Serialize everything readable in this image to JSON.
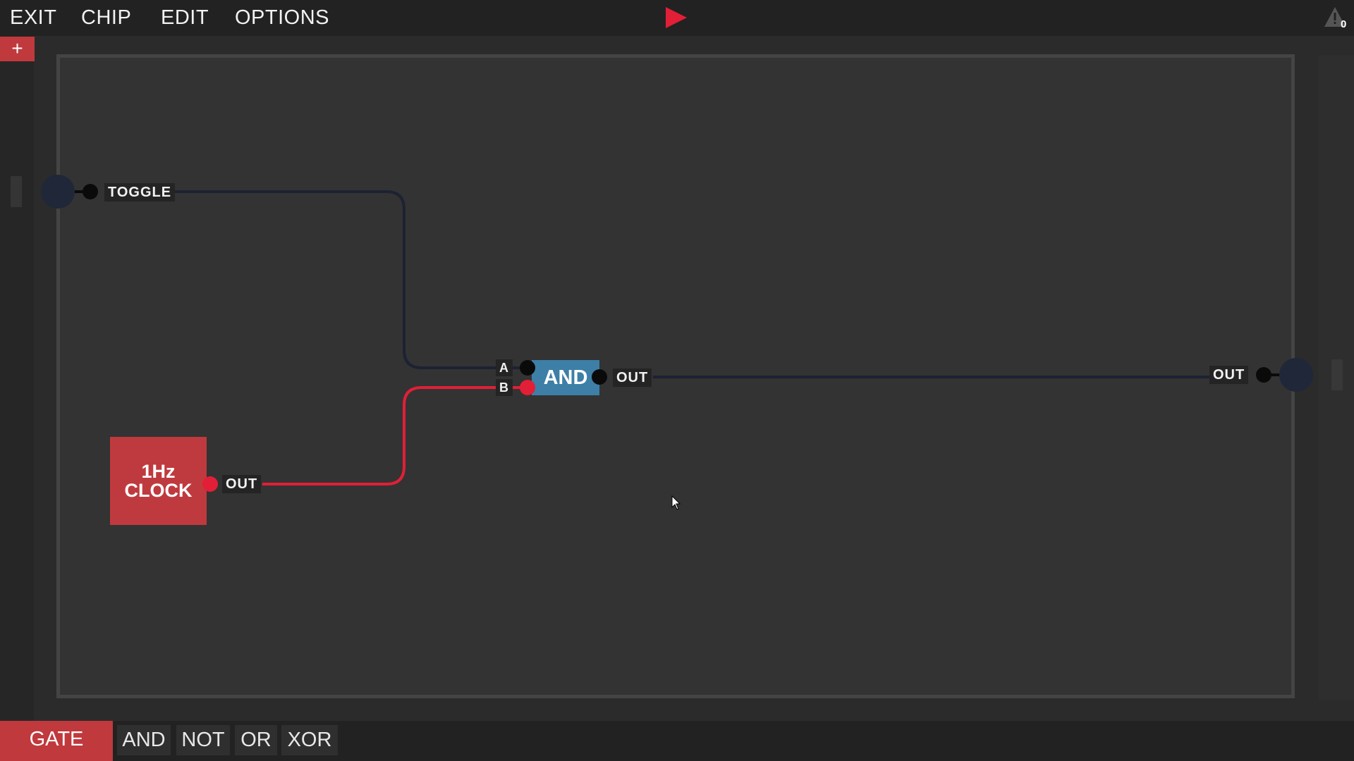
{
  "menu": {
    "exit": "EXIT",
    "chip": "CHIP",
    "edit": "EDIT",
    "options": "OPTIONS"
  },
  "toolbar": {
    "play_icon": "play-icon",
    "warning_icon": "warning-icon",
    "warning_count": "0"
  },
  "sidebar": {
    "add_label": "+"
  },
  "board": {
    "input_pin_label": "TOGGLE",
    "output_pin_label": "OUT",
    "and_chip": {
      "name": "AND",
      "input_a": "A",
      "input_b": "B",
      "output": "OUT"
    },
    "clock_chip": {
      "line1": "1Hz",
      "line2": "CLOCK",
      "output": "OUT"
    },
    "colors": {
      "wire_off": "#1c2233",
      "wire_on": "#e21f36",
      "and_chip": "#3d7fa6",
      "clock_chip": "#bf3a3e"
    }
  },
  "palette": {
    "category": "GATE",
    "items": [
      "AND",
      "NOT",
      "OR",
      "XOR"
    ]
  }
}
